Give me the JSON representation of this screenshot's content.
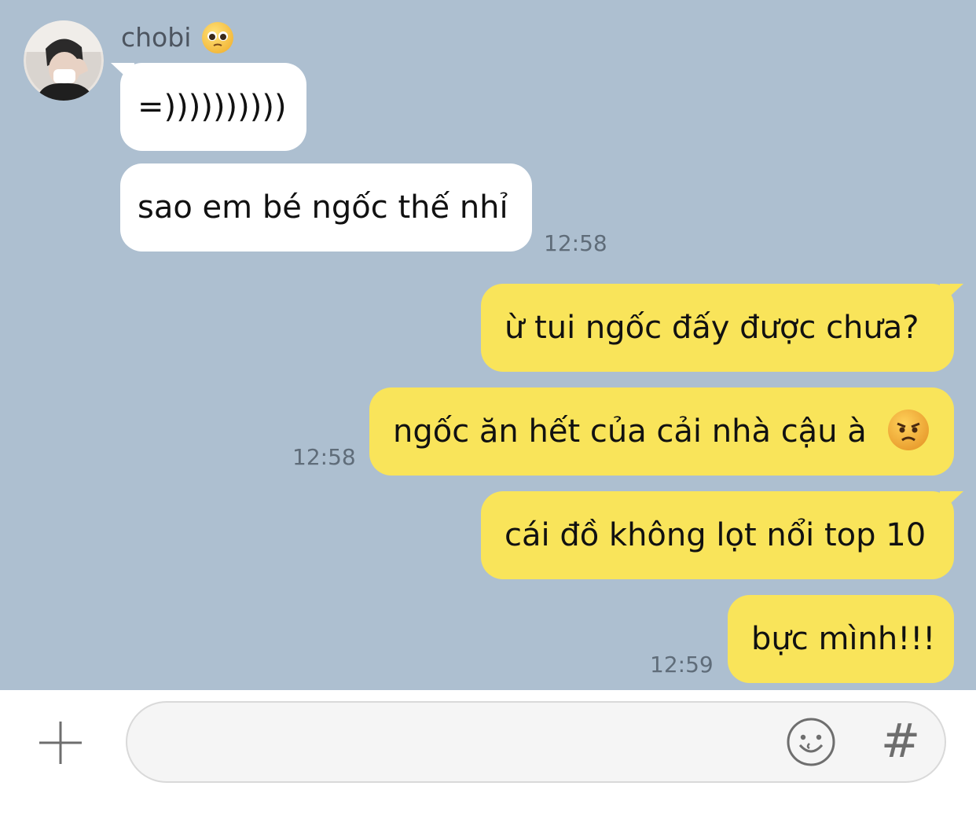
{
  "contact": {
    "name": "chobi"
  },
  "messages_in": [
    {
      "text": "=))))))))))"
    },
    {
      "text": "sao em bé ngốc thế nhỉ",
      "time": "12:58"
    }
  ],
  "messages_out": [
    {
      "text": "ừ tui ngốc đấy được chưa?"
    },
    {
      "text": "ngốc ăn hết của cải nhà cậu à",
      "time": "12:58"
    },
    {
      "text": "cái đồ không lọt nổi top 10"
    },
    {
      "text": "bực mình!!!",
      "time": "12:59"
    }
  ],
  "icons": {
    "avatar": "avatar-photo",
    "name_emoji": "pleading-face-icon",
    "angry_emoji": "angry-face-icon",
    "plus": "plus-icon",
    "emoji_button": "smiley-icon",
    "hashtag": "hash-icon"
  },
  "colors": {
    "chat_background": "#adbfd0",
    "incoming_bubble": "#ffffff",
    "outgoing_bubble": "#f9e45a"
  },
  "input": {
    "placeholder": "",
    "value": ""
  }
}
